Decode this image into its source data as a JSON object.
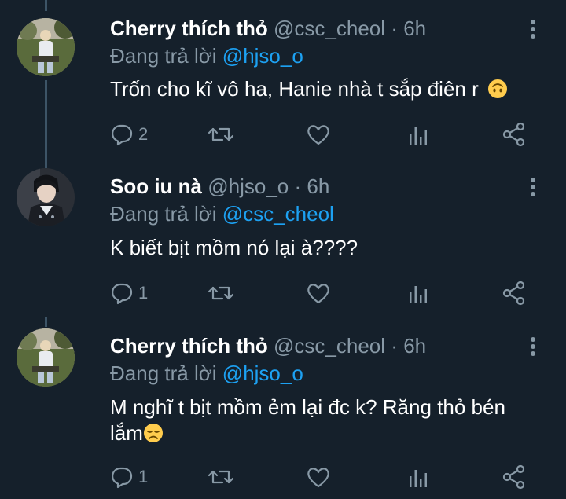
{
  "colors": {
    "background": "#15202b",
    "secondary_text": "#8899a6",
    "link": "#1da1f2",
    "thread_line": "#3d5466"
  },
  "tweets": [
    {
      "name": "Cherry thích thỏ",
      "handle": "@csc_cheol",
      "dot": "·",
      "time": "6h",
      "replying_label": "Đang trả lời",
      "replying_to": "@hjso_o",
      "text": "Trốn cho kĩ vô ha, Hanie nhà t sắp điên r",
      "emoji": "upside-down-face-icon",
      "reply_count": "2",
      "retweet_count": "",
      "like_count": ""
    },
    {
      "name": "Soo iu nà",
      "handle": "@hjso_o",
      "dot": "·",
      "time": "6h",
      "replying_label": "Đang trả lời",
      "replying_to": "@csc_cheol",
      "text": "K biết bịt mồm nó lại à????",
      "emoji": "",
      "reply_count": "1",
      "retweet_count": "",
      "like_count": ""
    },
    {
      "name": "Cherry thích thỏ",
      "handle": "@csc_cheol",
      "dot": "·",
      "time": "6h",
      "replying_label": "Đang trả lời",
      "replying_to": "@hjso_o",
      "text": "M nghĩ t bịt mồm ẻm lại đc k? Răng thỏ bén lắm",
      "emoji": "disappointed-face-icon",
      "reply_count": "1",
      "retweet_count": "",
      "like_count": ""
    }
  ],
  "icons": {
    "reply": "reply-icon",
    "retweet": "retweet-icon",
    "like": "heart-icon",
    "analytics": "analytics-icon",
    "share": "share-icon",
    "more": "more-vertical-icon"
  }
}
